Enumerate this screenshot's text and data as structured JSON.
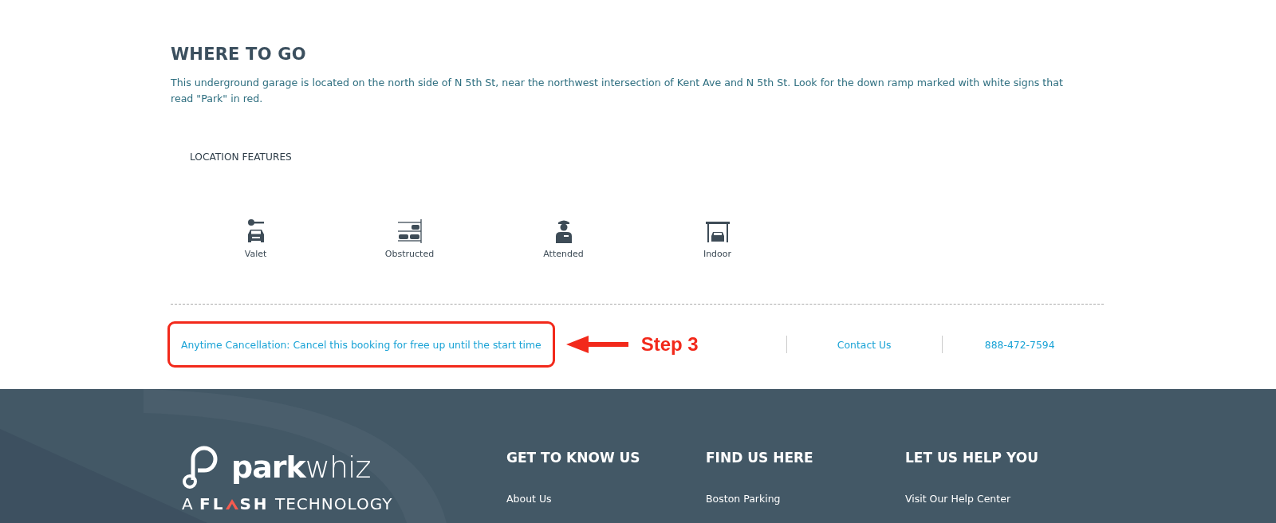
{
  "where_to_go": {
    "heading": "WHERE TO GO",
    "description": "This underground garage is located on the north side of N 5th St, near the northwest intersection of Kent Ave and N 5th St. Look for the down ramp marked with white signs that read \"Park\" in red."
  },
  "location_features": {
    "heading": "LOCATION FEATURES",
    "items": [
      {
        "kind": "valet",
        "label": "Valet"
      },
      {
        "kind": "obstructed",
        "label": "Obstructed"
      },
      {
        "kind": "attended",
        "label": "Attended"
      },
      {
        "kind": "indoor",
        "label": "Indoor"
      }
    ]
  },
  "info_bar": {
    "cancellation": "Anytime Cancellation: Cancel this booking for free up until the start time",
    "annotation": "Step 3",
    "contact": "Contact Us",
    "phone": "888-472-7594"
  },
  "footer": {
    "logo": "**park**whiz",
    "tagline": {
      "prefix": "A",
      "brand_start": "FL",
      "brand_end": "SH",
      "suffix": "TECHNOLOGY"
    },
    "columns": [
      {
        "heading": "GET TO KNOW US",
        "links": [
          "About Us"
        ]
      },
      {
        "heading": "FIND US HERE",
        "links": [
          "Boston Parking"
        ]
      },
      {
        "heading": "LET US HELP YOU",
        "links": [
          "Visit Our Help Center"
        ]
      }
    ]
  }
}
